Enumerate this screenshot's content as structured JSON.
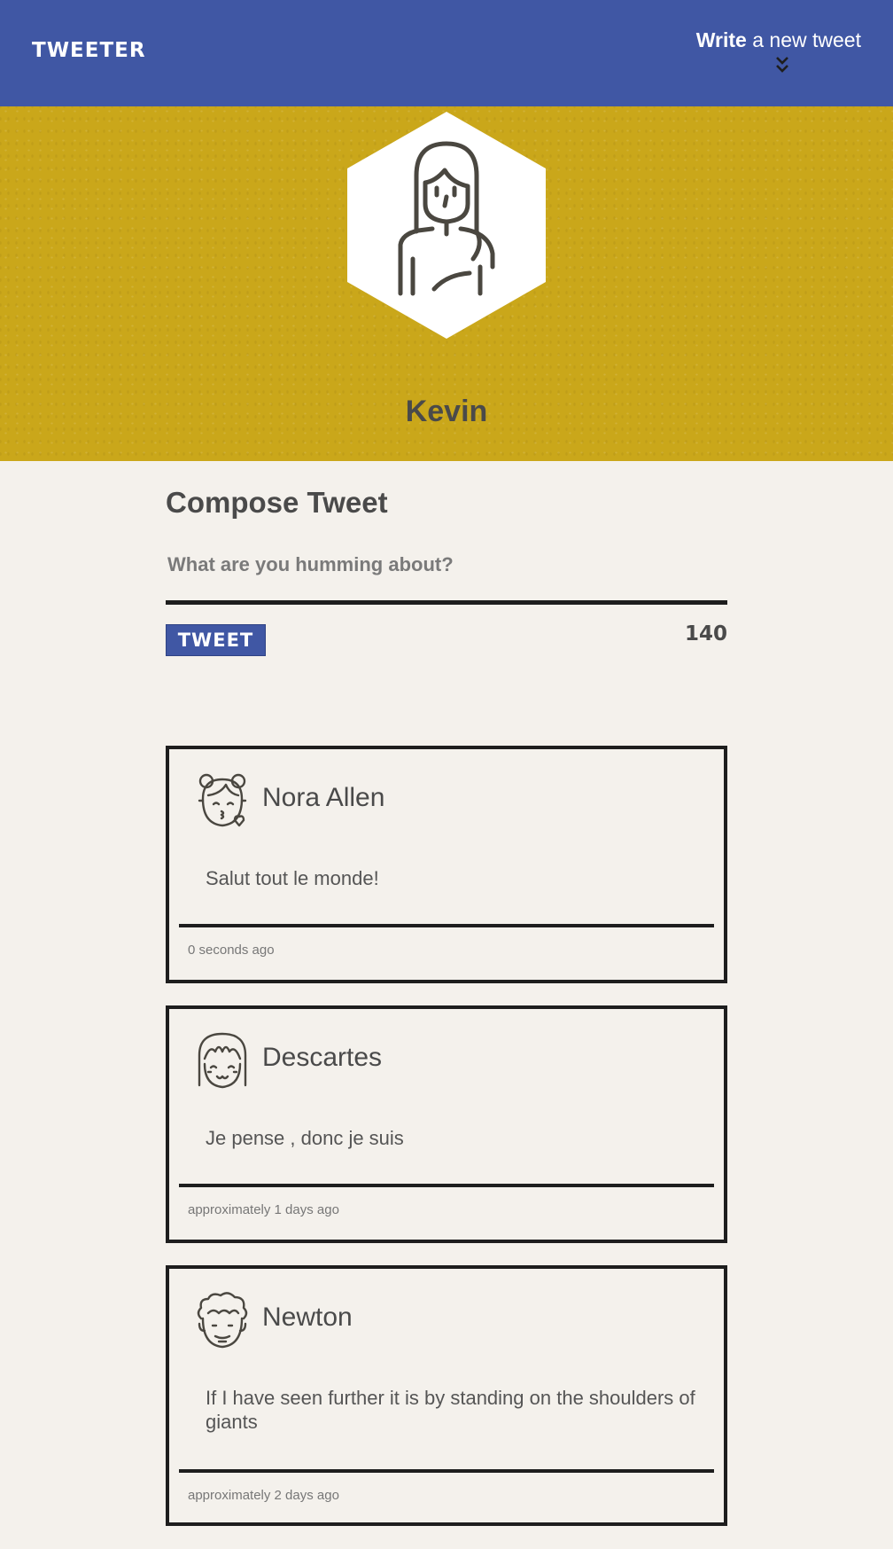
{
  "header": {
    "logo": "TWEETER",
    "write_bold": "Write",
    "write_rest": " a new tweet",
    "toggle_icon": "double-chevron-down-icon"
  },
  "profile": {
    "name": "Kevin",
    "avatar_icon": "woman-avatar-icon"
  },
  "compose": {
    "title": "Compose Tweet",
    "placeholder": "What are you humming about?",
    "button_label": "TWEET",
    "counter": "140"
  },
  "tweets": [
    {
      "name": "Nora Allen",
      "avatar_icon": "girl-kiss-avatar-icon",
      "text": "Salut tout le monde!",
      "time": "0 seconds ago"
    },
    {
      "name": "Descartes",
      "avatar_icon": "girl-bangs-avatar-icon",
      "text": "Je pense , donc je suis",
      "time": "approximately 1 days ago"
    },
    {
      "name": "Newton",
      "avatar_icon": "curly-hair-avatar-icon",
      "text": "If I have seen further it is by standing on the shoulders of giants",
      "time": "approximately 2 days ago"
    }
  ],
  "colors": {
    "nav": "#4057a4",
    "hero": "#caa71a",
    "background": "#f4f1ec",
    "border": "#1e1e1e"
  }
}
